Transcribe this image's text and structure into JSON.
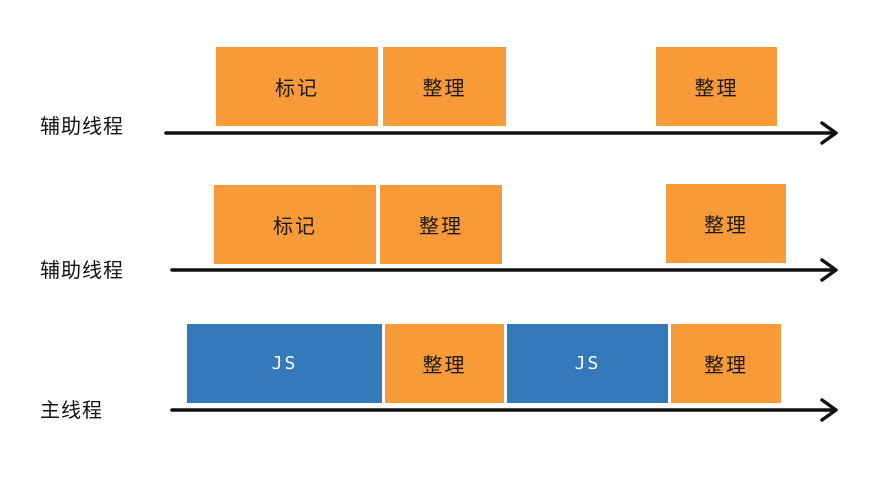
{
  "colors": {
    "orange": "#f89a38",
    "blue": "#3479b9",
    "line": "#111111"
  },
  "lanes": [
    {
      "label": "辅助线程",
      "blocks": [
        {
          "text": "标记",
          "color": "orange"
        },
        {
          "text": "整理",
          "color": "orange"
        },
        {
          "text": "整理",
          "color": "orange"
        }
      ]
    },
    {
      "label": "辅助线程",
      "blocks": [
        {
          "text": "标记",
          "color": "orange"
        },
        {
          "text": "整理",
          "color": "orange"
        },
        {
          "text": "整理",
          "color": "orange"
        }
      ]
    },
    {
      "label": "主线程",
      "blocks": [
        {
          "text": "JS",
          "color": "blue"
        },
        {
          "text": "整理",
          "color": "orange"
        },
        {
          "text": "JS",
          "color": "blue"
        },
        {
          "text": "整理",
          "color": "orange"
        }
      ]
    }
  ]
}
